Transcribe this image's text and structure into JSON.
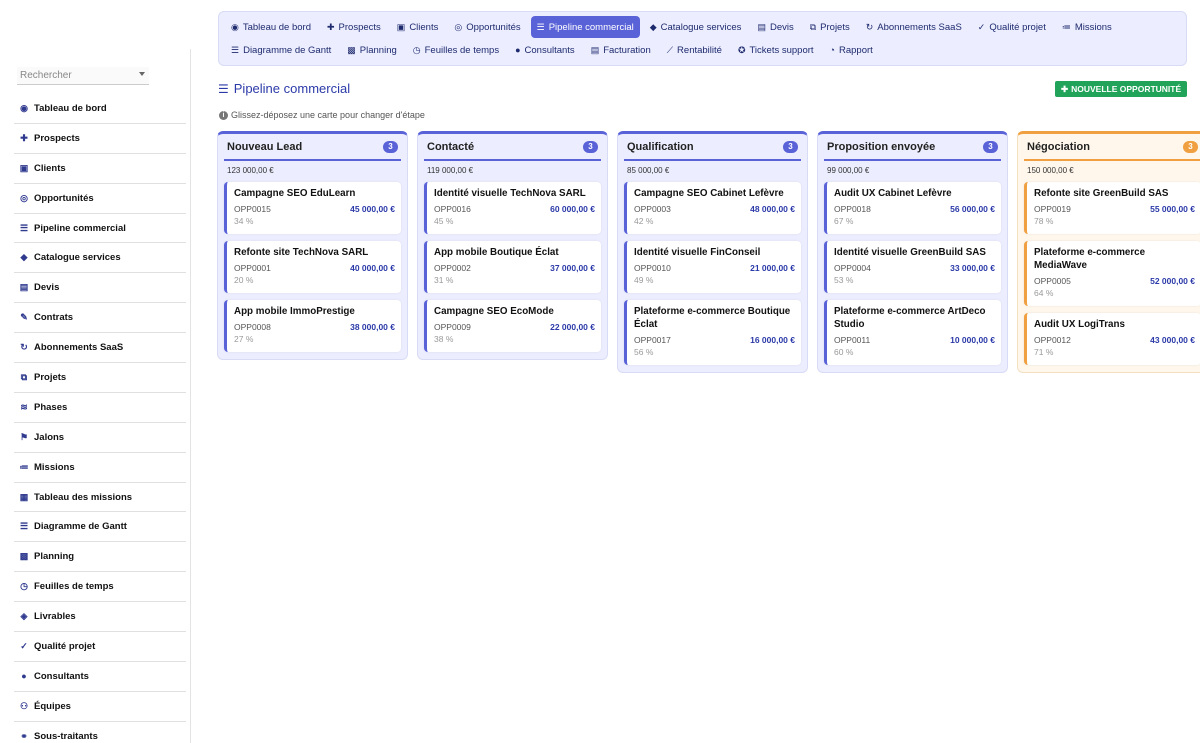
{
  "sidebar": {
    "search_placeholder": "Rechercher",
    "items": [
      {
        "label": "Tableau de bord",
        "icon": "dashboard-icon",
        "glyph": "◉"
      },
      {
        "label": "Prospects",
        "icon": "user-plus-icon",
        "glyph": "✚"
      },
      {
        "label": "Clients",
        "icon": "id-card-icon",
        "glyph": "▣"
      },
      {
        "label": "Opportunités",
        "icon": "target-icon",
        "glyph": "◎"
      },
      {
        "label": "Pipeline commercial",
        "icon": "bars-icon",
        "glyph": "☰"
      },
      {
        "label": "Catalogue services",
        "icon": "tags-icon",
        "glyph": "◆"
      },
      {
        "label": "Devis",
        "icon": "file-invoice-icon",
        "glyph": "▤"
      },
      {
        "label": "Contrats",
        "icon": "file-signature-icon",
        "glyph": "✎"
      },
      {
        "label": "Abonnements SaaS",
        "icon": "sync-icon",
        "glyph": "↻"
      },
      {
        "label": "Projets",
        "icon": "project-diagram-icon",
        "glyph": "⧉"
      },
      {
        "label": "Phases",
        "icon": "layers-icon",
        "glyph": "≋"
      },
      {
        "label": "Jalons",
        "icon": "flag-icon",
        "glyph": "⚑"
      },
      {
        "label": "Missions",
        "icon": "list-icon",
        "glyph": "≔"
      },
      {
        "label": "Tableau des missions",
        "icon": "table-icon",
        "glyph": "▦"
      },
      {
        "label": "Diagramme de Gantt",
        "icon": "gantt-icon",
        "glyph": "☰"
      },
      {
        "label": "Planning",
        "icon": "calendar-icon",
        "glyph": "▩"
      },
      {
        "label": "Feuilles de temps",
        "icon": "clock-icon",
        "glyph": "◷"
      },
      {
        "label": "Livrables",
        "icon": "box-icon",
        "glyph": "◈"
      },
      {
        "label": "Qualité projet",
        "icon": "clipboard-check-icon",
        "glyph": "✓"
      },
      {
        "label": "Consultants",
        "icon": "user-icon",
        "glyph": "●"
      },
      {
        "label": "Équipes",
        "icon": "users-icon",
        "glyph": "⚇"
      },
      {
        "label": "Sous-traitants",
        "icon": "handshake-icon",
        "glyph": "⚭"
      }
    ]
  },
  "topnav": {
    "row1": [
      {
        "label": "Tableau de bord",
        "icon": "dashboard-icon",
        "glyph": "◉",
        "active": false
      },
      {
        "label": "Prospects",
        "icon": "user-plus-icon",
        "glyph": "✚",
        "active": false
      },
      {
        "label": "Clients",
        "icon": "id-card-icon",
        "glyph": "▣",
        "active": false
      },
      {
        "label": "Opportunités",
        "icon": "target-icon",
        "glyph": "◎",
        "active": false
      },
      {
        "label": "Pipeline commercial",
        "icon": "bars-icon",
        "glyph": "☰",
        "active": true
      },
      {
        "label": "Catalogue services",
        "icon": "tags-icon",
        "glyph": "◆",
        "active": false
      },
      {
        "label": "Devis",
        "icon": "file-invoice-icon",
        "glyph": "▤",
        "active": false
      },
      {
        "label": "Projets",
        "icon": "project-diagram-icon",
        "glyph": "⧉",
        "active": false
      },
      {
        "label": "Abonnements SaaS",
        "icon": "sync-icon",
        "glyph": "↻",
        "active": false
      },
      {
        "label": "Qualité projet",
        "icon": "clipboard-check-icon",
        "glyph": "✓",
        "active": false
      },
      {
        "label": "Missions",
        "icon": "list-icon",
        "glyph": "≔",
        "active": false
      }
    ],
    "row2": [
      {
        "label": "Diagramme de Gantt",
        "icon": "gantt-icon",
        "glyph": "☰",
        "active": false
      },
      {
        "label": "Planning",
        "icon": "calendar-icon",
        "glyph": "▩",
        "active": false
      },
      {
        "label": "Feuilles de temps",
        "icon": "clock-icon",
        "glyph": "◷",
        "active": false
      },
      {
        "label": "Consultants",
        "icon": "user-icon",
        "glyph": "●",
        "active": false
      },
      {
        "label": "Facturation",
        "icon": "file-invoice-icon",
        "glyph": "▤",
        "active": false
      },
      {
        "label": "Rentabilité",
        "icon": "chart-line-icon",
        "glyph": "⟋",
        "active": false
      },
      {
        "label": "Tickets support",
        "icon": "support-icon",
        "glyph": "✪",
        "active": false
      },
      {
        "label": "Rapport",
        "icon": "pie-chart-icon",
        "glyph": "◔",
        "active": false
      }
    ]
  },
  "page": {
    "title": "Pipeline commercial",
    "title_glyph": "☰",
    "new_button": "NOUVELLE OPPORTUNITÉ",
    "new_button_glyph": "✚",
    "hint": "Glissez-déposez une carte pour changer d'étape",
    "hint_glyph": "i"
  },
  "columns": [
    {
      "title": "Nouveau Lead",
      "count": "3",
      "total": "123 000,00 €",
      "color": "#5a62d8",
      "cards": [
        {
          "title": "Campagne SEO EduLearn",
          "ref": "OPP0015",
          "amount": "45 000,00 €",
          "pct": "34 %"
        },
        {
          "title": "Refonte site TechNova SARL",
          "ref": "OPP0001",
          "amount": "40 000,00 €",
          "pct": "20 %"
        },
        {
          "title": "App mobile ImmoPrestige",
          "ref": "OPP0008",
          "amount": "38 000,00 €",
          "pct": "27 %"
        }
      ]
    },
    {
      "title": "Contacté",
      "count": "3",
      "total": "119 000,00 €",
      "color": "#5a62d8",
      "cards": [
        {
          "title": "Identité visuelle TechNova SARL",
          "ref": "OPP0016",
          "amount": "60 000,00 €",
          "pct": "45 %"
        },
        {
          "title": "App mobile Boutique Éclat",
          "ref": "OPP0002",
          "amount": "37 000,00 €",
          "pct": "31 %"
        },
        {
          "title": "Campagne SEO EcoMode",
          "ref": "OPP0009",
          "amount": "22 000,00 €",
          "pct": "38 %"
        }
      ]
    },
    {
      "title": "Qualification",
      "count": "3",
      "total": "85 000,00 €",
      "color": "#5a62d8",
      "cards": [
        {
          "title": "Campagne SEO Cabinet Lefèvre",
          "ref": "OPP0003",
          "amount": "48 000,00 €",
          "pct": "42 %"
        },
        {
          "title": "Identité visuelle FinConseil",
          "ref": "OPP0010",
          "amount": "21 000,00 €",
          "pct": "49 %"
        },
        {
          "title": "Plateforme e-commerce Boutique Éclat",
          "ref": "OPP0017",
          "amount": "16 000,00 €",
          "pct": "56 %"
        }
      ]
    },
    {
      "title": "Proposition envoyée",
      "count": "3",
      "total": "99 000,00 €",
      "color": "#5a62d8",
      "cards": [
        {
          "title": "Audit UX Cabinet Lefèvre",
          "ref": "OPP0018",
          "amount": "56 000,00 €",
          "pct": "67 %"
        },
        {
          "title": "Identité visuelle GreenBuild SAS",
          "ref": "OPP0004",
          "amount": "33 000,00 €",
          "pct": "53 %"
        },
        {
          "title": "Plateforme e-commerce ArtDeco Studio",
          "ref": "OPP0011",
          "amount": "10 000,00 €",
          "pct": "60 %"
        }
      ]
    },
    {
      "title": "Négociation",
      "count": "3",
      "total": "150 000,00 €",
      "color": "#f0a040",
      "cards": [
        {
          "title": "Refonte site GreenBuild SAS",
          "ref": "OPP0019",
          "amount": "55 000,00 €",
          "pct": "78 %"
        },
        {
          "title": "Plateforme e-commerce MediaWave",
          "ref": "OPP0005",
          "amount": "52 000,00 €",
          "pct": "64 %"
        },
        {
          "title": "Audit UX LogiTrans",
          "ref": "OPP0012",
          "amount": "43 000,00 €",
          "pct": "71 %"
        }
      ]
    }
  ]
}
